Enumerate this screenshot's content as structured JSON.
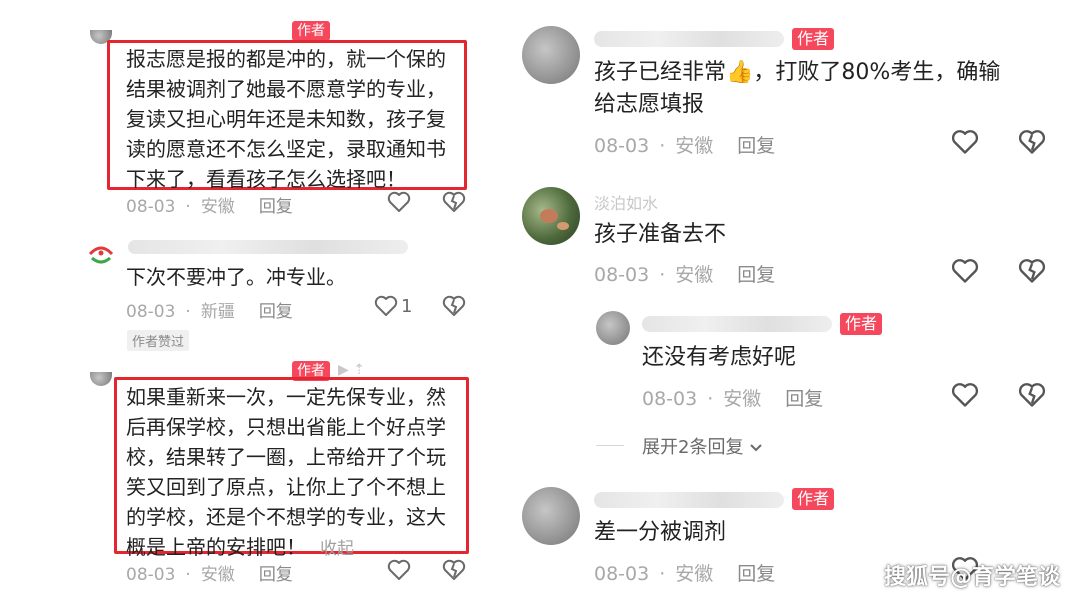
{
  "left": {
    "c1": {
      "author_tag": "作者",
      "lines": [
        "报志愿是报的都是冲的，就一个保的",
        "结果被调剂了她最不愿意学的专业，",
        "复读又担心明年还是未知数，孩子复",
        "读的愿意还不怎么坚定，录取通知书",
        "下来了，看看孩子怎么选择吧！"
      ],
      "date": "08-03",
      "location": "安徽",
      "reply": "回复"
    },
    "c2": {
      "text": "下次不要冲了。冲专业。",
      "date": "08-03",
      "location": "新疆",
      "reply": "回复",
      "like_count": "1",
      "liked_badge": "作者赞过"
    },
    "c3": {
      "author_tag": "作者",
      "lines": [
        "如果重新来一次，一定先保专业，然",
        "后再保学校，只想出省能上个好点学",
        "校，结果转了一圈，上帝给开了个玩",
        "笑又回到了原点，让你上了个不想上",
        "的学校，还是个不想学的专业，这大",
        "概是上帝的安排吧！"
      ],
      "collapse": "收起",
      "date": "08-03",
      "location": "安徽",
      "reply": "回复"
    }
  },
  "right": {
    "r1": {
      "author_tag": "作者",
      "line1_a": "孩子已经非常",
      "line1_b": "，打败了80%考生，确输",
      "line2": "给志愿填报",
      "date": "08-03",
      "location": "安徽",
      "reply": "回复"
    },
    "r2": {
      "name": "淡泊如水",
      "text": "孩子准备去不",
      "date": "08-03",
      "location": "安徽",
      "reply": "回复"
    },
    "r3": {
      "author_tag": "作者",
      "text": "还没有考虑好呢",
      "date": "08-03",
      "location": "安徽",
      "reply": "回复"
    },
    "expand": "展开2条回复",
    "r4": {
      "author_tag": "作者",
      "text": "差一分被调剂",
      "date": "08-03",
      "location": "安徽",
      "reply": "回复"
    }
  },
  "watermark": "搜狐号@育学笔谈",
  "colors": {
    "author_tag": "#f5485c",
    "highlight_box": "#e3262f"
  },
  "icons": [
    "heart-icon",
    "dislike-icon",
    "chevron-down-icon",
    "thumbs-up-emoji"
  ]
}
